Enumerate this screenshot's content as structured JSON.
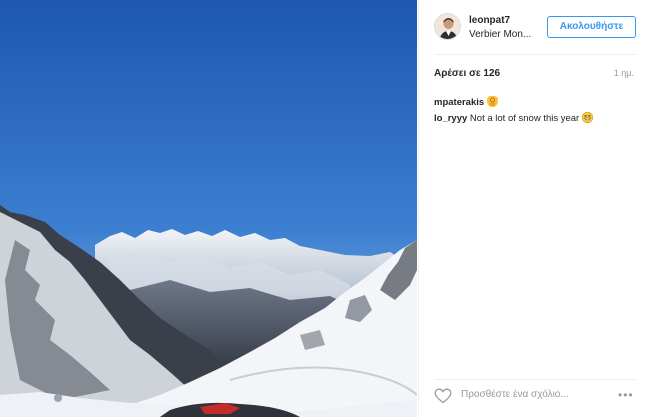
{
  "post": {
    "username": "leonpat7",
    "location": "Verbier Mon...",
    "follow_label": "Ακολουθήστε",
    "likes_text": "Αρέσει σε 126",
    "time_ago": "1 ημ."
  },
  "comments": [
    {
      "user": "mpaterakis",
      "text": "",
      "emoji": "ok-hand-emoji"
    },
    {
      "user": "lo_ryyy",
      "text": "Not a lot of snow this year",
      "emoji": "grinning-face-emoji"
    }
  ],
  "actions": {
    "add_comment_placeholder": "Προσθέστε ένα σχόλιο...",
    "more_options": "•••",
    "like_icon": "heart-icon"
  },
  "photo": {
    "description_icon": "mountain-photo",
    "colors": {
      "sky_top": "#1f5db8",
      "sky_bottom": "#8fb7e4",
      "snow": "#eef1f6",
      "rock": "#3a3d45"
    }
  },
  "colors": {
    "accent": "#3897f0",
    "muted": "#999999",
    "text": "#262626",
    "border": "#efefef"
  }
}
